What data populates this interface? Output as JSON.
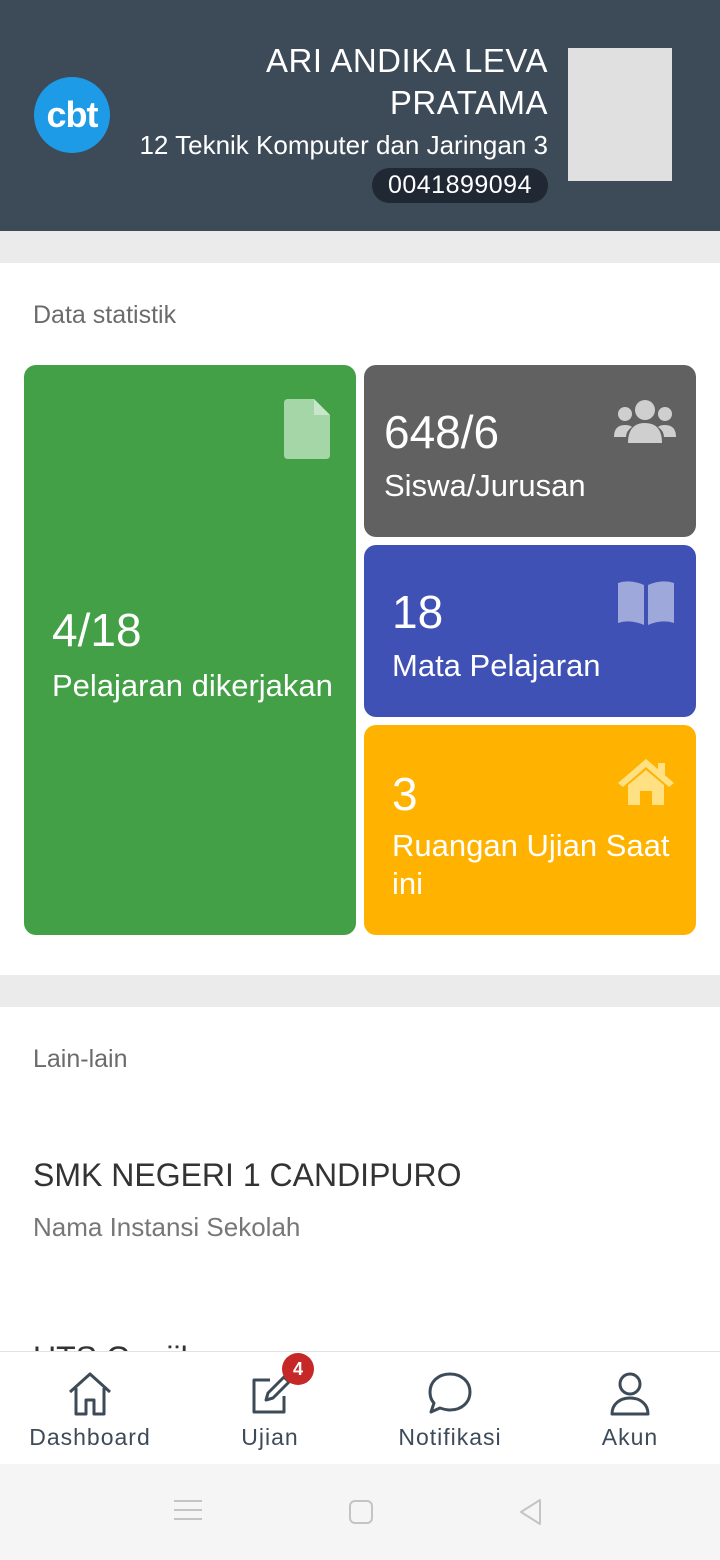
{
  "header": {
    "logo_text": "cbt",
    "name_line1": "ARI ANDIKA LEVA",
    "name_line2": "PRATAMA",
    "class": "12 Teknik Komputer dan Jaringan 3",
    "nis": "0041899094"
  },
  "stats": {
    "title": "Data statistik",
    "tiles": [
      {
        "value": "4/18",
        "label": "Pelajaran dikerjakan",
        "icon": "document-icon",
        "color": "#43a047"
      },
      {
        "value": "648/6",
        "label": "Siswa/Jurusan",
        "icon": "users-icon",
        "color": "#616161"
      },
      {
        "value": "18",
        "label": "Mata Pelajaran",
        "icon": "book-icon",
        "color": "#3f51b5"
      },
      {
        "value": "3",
        "label": "Ruangan Ujian Saat ini",
        "icon": "home-icon",
        "color": "#ffb300"
      }
    ]
  },
  "other": {
    "title": "Lain-lain",
    "items": [
      {
        "title": "SMK NEGERI 1 CANDIPURO",
        "subtitle": "Nama Instansi Sekolah"
      },
      {
        "title": "UTS Ganjil",
        "subtitle": ""
      }
    ]
  },
  "nav": {
    "items": [
      {
        "label": "Dashboard",
        "icon": "home-icon"
      },
      {
        "label": "Ujian",
        "icon": "edit-icon",
        "badge": "4"
      },
      {
        "label": "Notifikasi",
        "icon": "chat-icon"
      },
      {
        "label": "Akun",
        "icon": "user-icon"
      }
    ]
  }
}
